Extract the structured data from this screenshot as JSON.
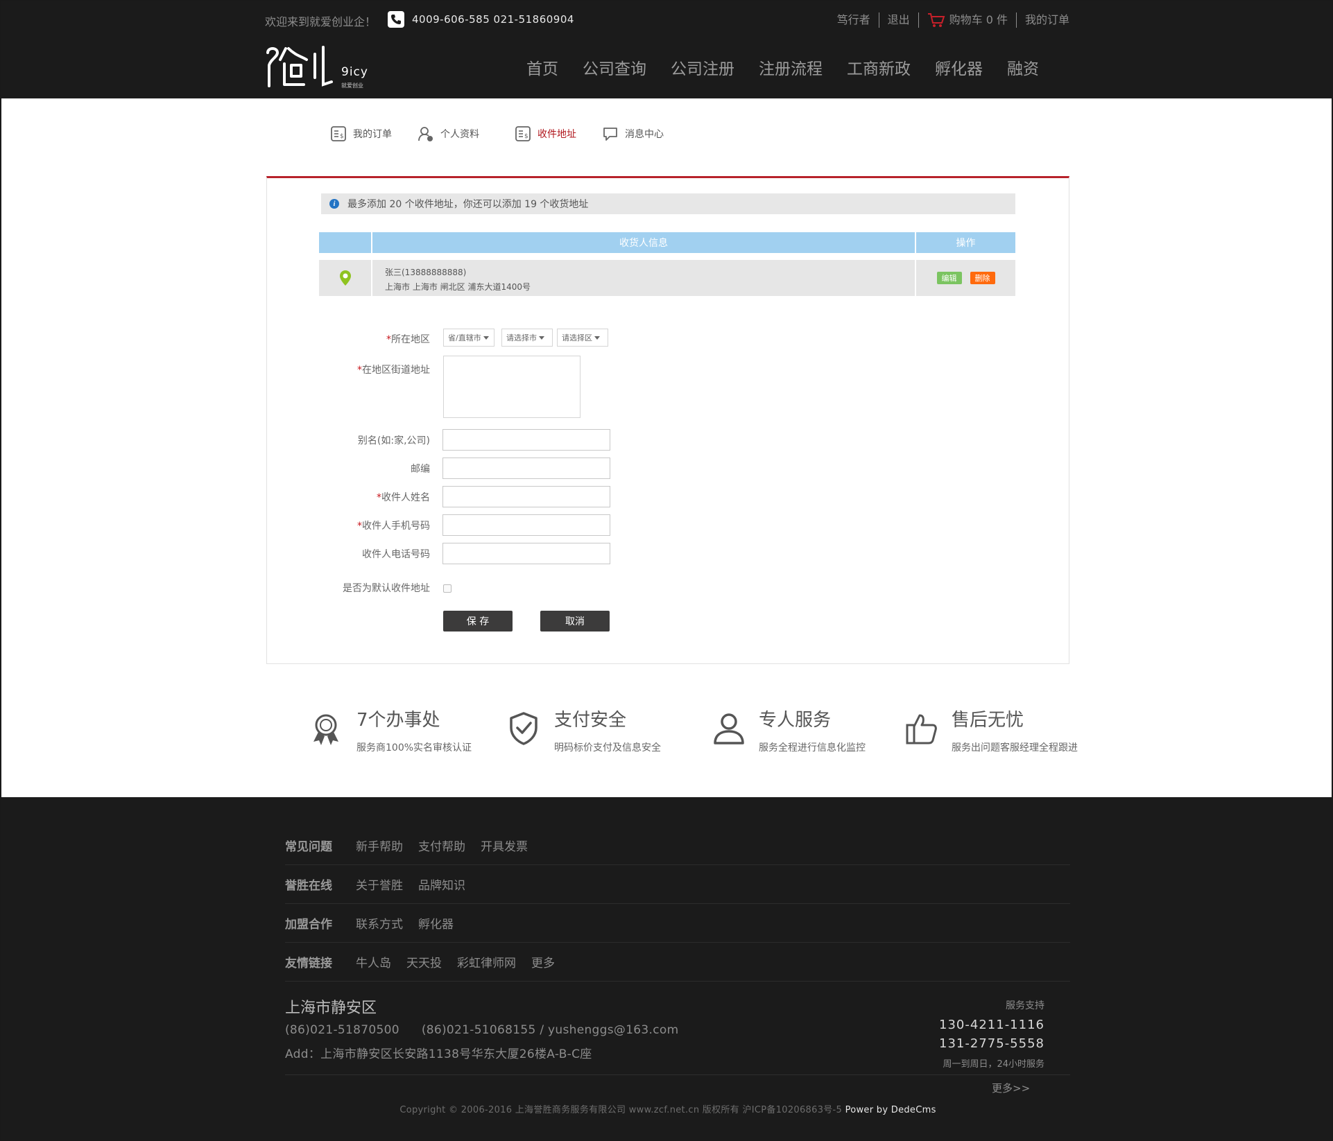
{
  "topbar": {
    "welcome": "欢迎来到就爱创业企！",
    "phones": "4009-606-585   021-51860904",
    "links": [
      "笃行者",
      "退出",
      "购物车 0 件",
      "我的订单"
    ]
  },
  "logo": {
    "en": "9icy",
    "cn": "就爱创业"
  },
  "nav": [
    "首页",
    "公司查询",
    "公司注册",
    "注册流程",
    "工商新政",
    "孵化器",
    "融资"
  ],
  "user_tabs": [
    {
      "label": "我的订单",
      "icon": "order-icon",
      "active": false
    },
    {
      "label": "个人资料",
      "icon": "user-profile-icon",
      "active": false
    },
    {
      "label": "收件地址",
      "icon": "address-icon",
      "active": true
    },
    {
      "label": "消息中心",
      "icon": "message-icon",
      "active": false
    }
  ],
  "notice": "最多添加 20 个收件地址，你还可以添加 19 个收货地址",
  "table": {
    "headers": [
      "收货人信息",
      "操作"
    ],
    "rows": [
      {
        "name_phone": "张三(13888888888)",
        "address": "上海市 上海市 闸北区 浦东大道1400号",
        "edit": "编辑",
        "delete": "删除"
      }
    ]
  },
  "form": {
    "region_label": "所在地区",
    "selects": [
      "省/直辖市",
      "请选择市",
      "请选择区"
    ],
    "street_label": "在地区街道地址",
    "alias_label": "别名(如:家,公司)",
    "zip_label": "邮编",
    "name_label": "收件人姓名",
    "mobile_label": "收件人手机号码",
    "phone_label": "收件人电话号码",
    "default_label": "是否为默认收件地址",
    "save": "保 存",
    "cancel": "取消"
  },
  "features": [
    {
      "title": "7个办事处",
      "sub": "服务商100%实名审核认证",
      "icon": "award-ribbon-icon"
    },
    {
      "title": "支付安全",
      "sub": "明码标价支付及信息安全",
      "icon": "shield-check-icon"
    },
    {
      "title": "专人服务",
      "sub": "服务全程进行信息化监控",
      "icon": "person-icon"
    },
    {
      "title": "售后无忧",
      "sub": "服务出问题客服经理全程跟进",
      "icon": "thumbs-up-icon"
    }
  ],
  "footer": {
    "rows": [
      {
        "title": "常见问题",
        "links": [
          "新手帮助",
          "支付帮助",
          "开具发票"
        ]
      },
      {
        "title": "誉胜在线",
        "links": [
          "关于誉胜",
          "品牌知识"
        ]
      },
      {
        "title": "加盟合作",
        "links": [
          "联系方式",
          "孵化器"
        ]
      },
      {
        "title": "友情链接",
        "links": [
          "牛人岛",
          "天天投",
          "彩虹律师网",
          "更多"
        ]
      }
    ],
    "location": "上海市静安区",
    "phone1": "(86)021-51870500",
    "phone2_email": "(86)021-51068155 / yushenggs@163.com",
    "address": "Add：上海市静安区长安路1138号华东大厦26楼A-B-C座",
    "support_label": "服务支持",
    "support_num1": "130-4211-1116",
    "support_num2": "131-2775-5558",
    "support_hours": "周一到周日，24小时服务",
    "more": "更多>>",
    "copyright": "Copyright © 2006-2016 上海誉胜商务服务有限公司 www.zcf.net.cn  版权所有  沪ICP备10206863号-5 ",
    "power": "Power by DedeCms"
  }
}
